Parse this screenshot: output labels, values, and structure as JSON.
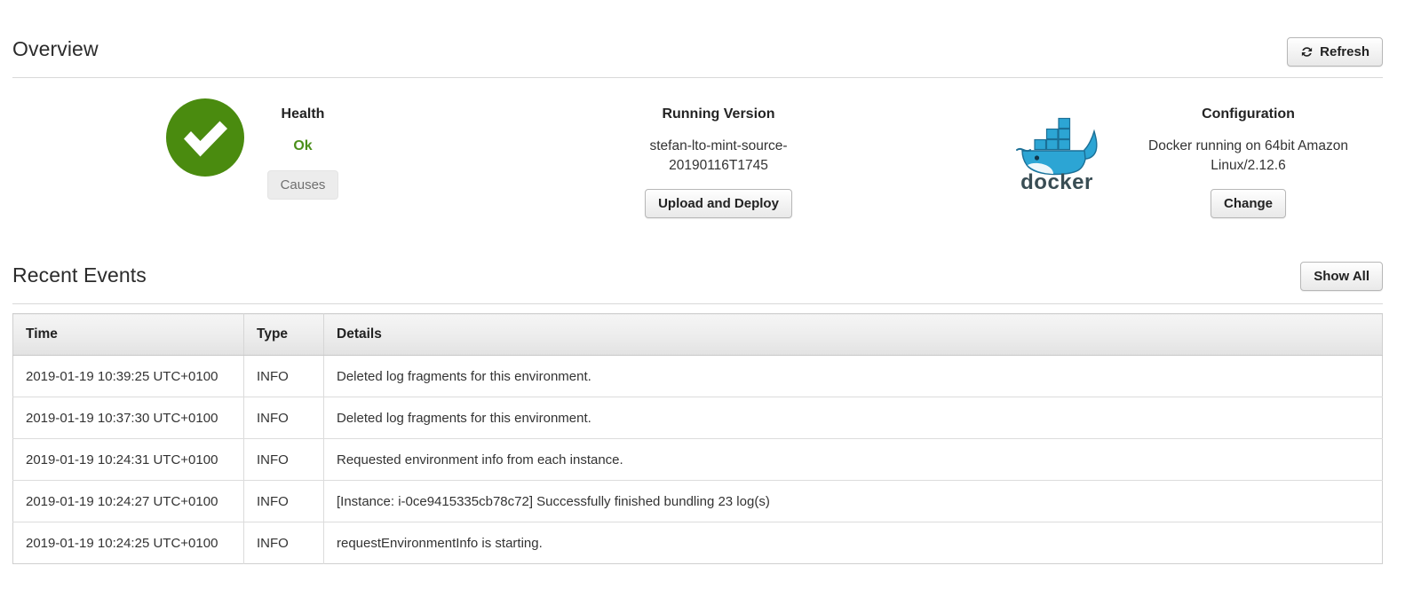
{
  "overview": {
    "title": "Overview",
    "refresh_label": "Refresh",
    "refresh_icon": "refresh-icon"
  },
  "health": {
    "label": "Health",
    "status": "Ok",
    "status_color": "#4b8f1b",
    "icon": "green-check-circle-icon",
    "icon_color": "#4a8b0f",
    "causes_label": "Causes"
  },
  "version": {
    "label": "Running Version",
    "value": "stefan-lto-mint-source-20190116T1745",
    "upload_label": "Upload and Deploy"
  },
  "configuration": {
    "label": "Configuration",
    "value": "Docker running on 64bit Amazon Linux/2.12.6",
    "change_label": "Change",
    "logo_icon": "docker-logo-icon",
    "logo_text": "docker",
    "logo_color": "#2496ed"
  },
  "events": {
    "title": "Recent Events",
    "show_all_label": "Show All",
    "columns": [
      "Time",
      "Type",
      "Details"
    ],
    "rows": [
      {
        "time": "2019-01-19 10:39:25 UTC+0100",
        "type": "INFO",
        "details": "Deleted log fragments for this environment."
      },
      {
        "time": "2019-01-19 10:37:30 UTC+0100",
        "type": "INFO",
        "details": "Deleted log fragments for this environment."
      },
      {
        "time": "2019-01-19 10:24:31 UTC+0100",
        "type": "INFO",
        "details": "Requested environment info from each instance."
      },
      {
        "time": "2019-01-19 10:24:27 UTC+0100",
        "type": "INFO",
        "details": "[Instance: i-0ce9415335cb78c72] Successfully finished bundling 23 log(s)"
      },
      {
        "time": "2019-01-19 10:24:25 UTC+0100",
        "type": "INFO",
        "details": "requestEnvironmentInfo is starting."
      }
    ]
  }
}
